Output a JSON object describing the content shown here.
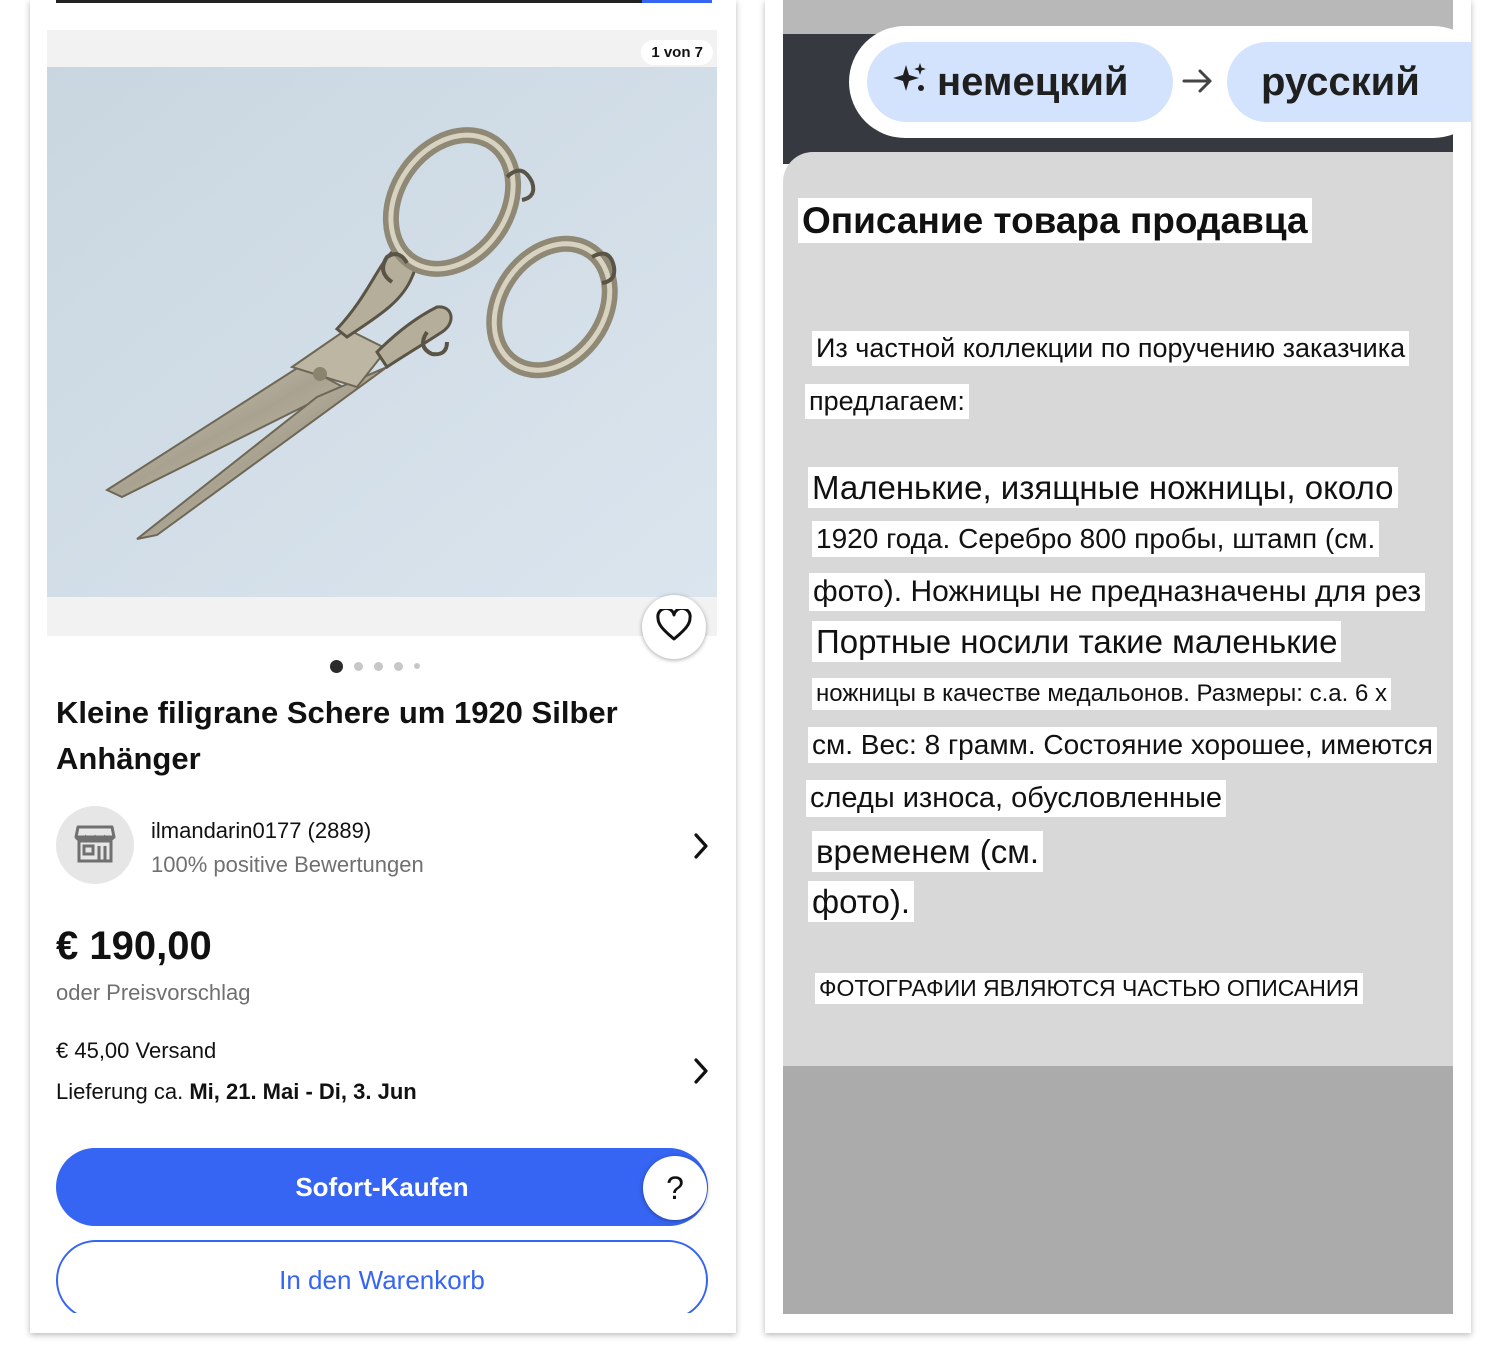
{
  "listing": {
    "image_counter": "1 von 7",
    "image_alt": "Silver filigree scissors",
    "title": "Kleine filigrane Schere um 1920 Silber Anhänger",
    "seller_name": "ilmandarin0177 (2889)",
    "seller_feedback": "100% positive Bewertungen",
    "price": "€ 190,00",
    "best_offer": "oder Preisvorschlag",
    "shipping": "€ 45,00 Versand",
    "delivery_prefix": "Lieferung ca. ",
    "delivery_dates": "Mi, 21. Mai - Di, 3. Jun",
    "buy_now_label": "Sofort-Kaufen",
    "help_label": "?",
    "add_to_cart_label": "In den Warenkorb",
    "icons": {
      "favorite": "heart-icon",
      "seller": "store-icon",
      "chevron": "chevron-right-icon"
    },
    "colors": {
      "accent": "#3665f3"
    }
  },
  "translation": {
    "source_language": "немецкий",
    "target_language": "русский",
    "heading": "Описание товара продавца",
    "lines": [
      "Из частной коллекции по поручению заказчика",
      "предлагаем:",
      "Маленькие, изящные ножницы, около",
      "1920 года. Серебро 800 пробы, штамп (см.",
      "фото). Ножницы не предназначены для рез",
      "Портные носили такие маленькие",
      "ножницы в качестве медальонов. Размеры: c.a. 6 x",
      "см. Вес: 8 грамм. Состояние хорошее, имеются",
      "следы износа, обусловленные",
      "временем (см.",
      "фото).",
      "ФОТОГРАФИИ ЯВЛЯЮТСЯ ЧАСТЬЮ ОПИСАНИЯ"
    ],
    "icons": {
      "sparkle": "sparkle-icon",
      "arrow": "arrow-right-icon"
    },
    "colors": {
      "chip": "#d3e3fd"
    }
  }
}
